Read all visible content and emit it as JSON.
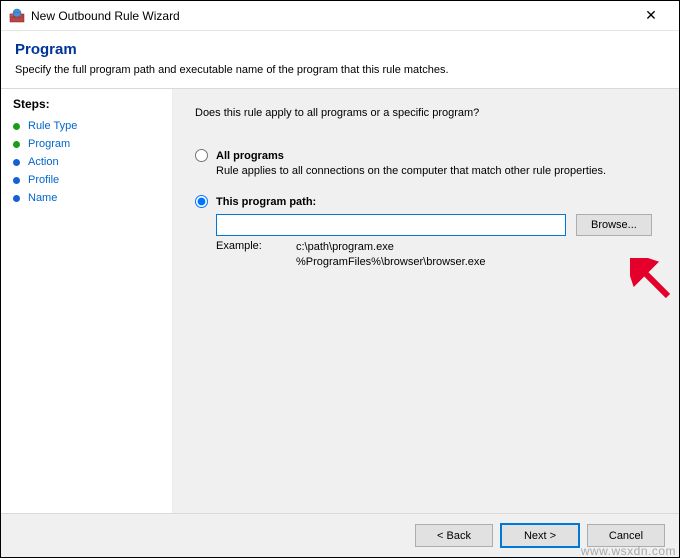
{
  "window": {
    "title": "New Outbound Rule Wizard",
    "close_glyph": "✕"
  },
  "header": {
    "title": "Program",
    "subtitle": "Specify the full program path and executable name of the program that this rule matches."
  },
  "sidebar": {
    "label": "Steps:",
    "items": [
      {
        "label": "Rule Type",
        "color": "#1a9e1a"
      },
      {
        "label": "Program",
        "color": "#1a9e1a"
      },
      {
        "label": "Action",
        "color": "#1560d4"
      },
      {
        "label": "Profile",
        "color": "#1560d4"
      },
      {
        "label": "Name",
        "color": "#1560d4"
      }
    ]
  },
  "main": {
    "question": "Does this rule apply to all programs or a specific program?",
    "opt_all": {
      "label": "All programs",
      "desc": "Rule applies to all connections on the computer that match other rule properties."
    },
    "opt_path": {
      "label": "This program path:",
      "input_value": "",
      "browse_label": "Browse...",
      "example_label": "Example:",
      "example_line1": "c:\\path\\program.exe",
      "example_line2": "%ProgramFiles%\\browser\\browser.exe"
    }
  },
  "footer": {
    "back": "< Back",
    "next": "Next >",
    "cancel": "Cancel"
  },
  "watermark": "www.wsxdn.com"
}
